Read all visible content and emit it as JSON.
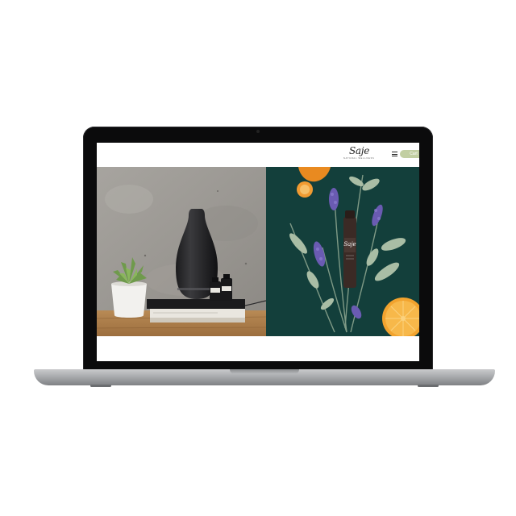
{
  "site": {
    "brand": "Saje",
    "brand_tagline": "natural wellness",
    "cart_label": "Cart",
    "menu_icon": "hamburger-menu-icon"
  },
  "hero": {
    "left_image": "aroma-diffuser-on-books-with-succulent",
    "right_image": "roll-on-bottle-with-lavender-sage-orange"
  },
  "colors": {
    "cart_button": "#c2cfa2",
    "right_panel_bg": "#133f3b",
    "laptop_bezel": "#0b0b0c",
    "laptop_body": "#a9abae"
  }
}
